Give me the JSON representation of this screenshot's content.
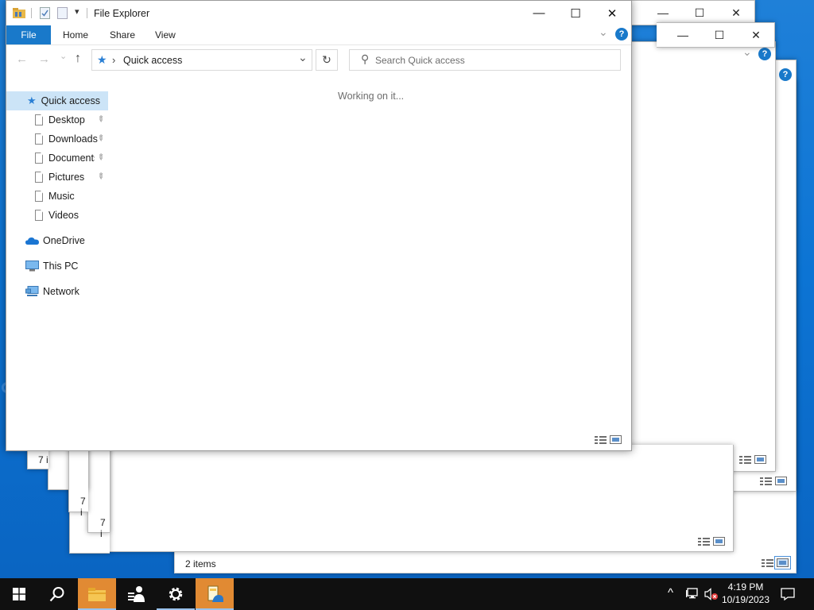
{
  "window": {
    "title": "File Explorer",
    "minimize_glyph": "—",
    "maximize_glyph": "☐",
    "close_glyph": "✕",
    "help_glyph": "?",
    "expand_glyph": "⌄"
  },
  "ribbon": {
    "tabs": [
      "File",
      "Home",
      "Share",
      "View"
    ]
  },
  "address": {
    "location": "Quick access",
    "separator": "›",
    "dropdown_glyph": "⌄",
    "refresh_glyph": "↻"
  },
  "nav_buttons": {
    "back": "←",
    "forward": "→",
    "recent": "⌄",
    "up": "↑"
  },
  "search": {
    "placeholder": "Search Quick access",
    "value": "",
    "icon_glyph": "⚲"
  },
  "content": {
    "status": "Working on it..."
  },
  "sidebar": {
    "quick_access": "Quick access",
    "items": [
      "Desktop",
      "Downloads",
      "Documents",
      "Pictures",
      "Music",
      "Videos"
    ],
    "onedrive": "OneDrive",
    "this_pc": "This PC",
    "network": "Network",
    "pin_glyph": "📌"
  },
  "background_windows": {
    "item_count_partial": "7 i",
    "status": "2 items"
  },
  "taskbar": {
    "time": "4:19 PM",
    "date": "10/19/2023",
    "tray_up_glyph": "^",
    "notification_glyph": "▭"
  },
  "colors": {
    "accent": "#1979ca",
    "selection": "#cce4f7",
    "desktop": "#0c74d4",
    "taskbar": "#101010"
  }
}
